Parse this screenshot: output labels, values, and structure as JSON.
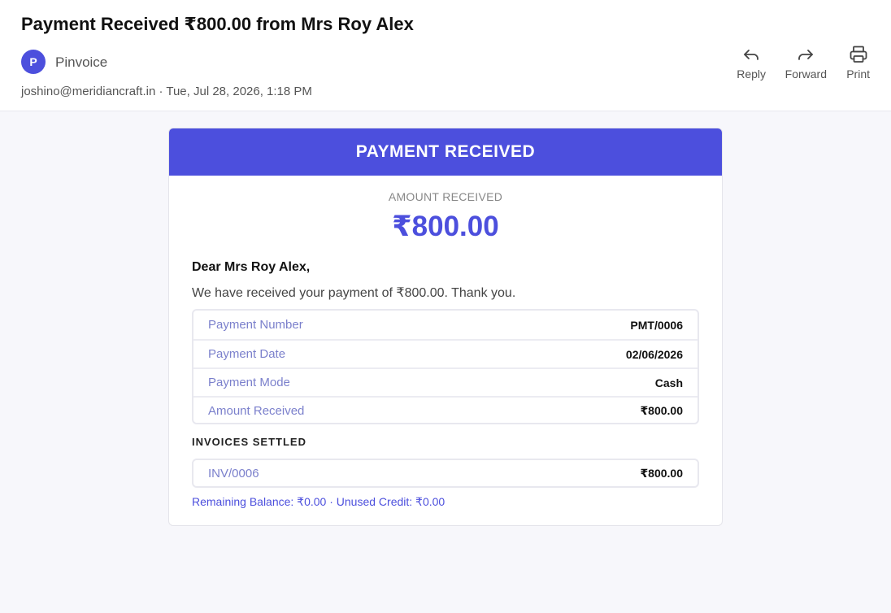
{
  "email": {
    "subject": "Payment Received ₹800.00 from Mrs Roy Alex",
    "sender": {
      "avatar_letter": "P",
      "name": "Pinvoice",
      "meta": "joshino@meridiancraft.in · Tue, Jul 28, 2026, 1:18 PM"
    },
    "actions": {
      "reply": "Reply",
      "forward": "Forward",
      "print": "Print"
    }
  },
  "receipt": {
    "banner": "PAYMENT RECEIVED",
    "amount_label": "AMOUNT RECEIVED",
    "amount": "₹800.00",
    "greeting": "Dear Mrs Roy Alex,",
    "message": "We have received your payment of ₹800.00. Thank you.",
    "details": [
      {
        "label": "Payment Number",
        "value": "PMT/0006"
      },
      {
        "label": "Payment Date",
        "value": "02/06/2026"
      },
      {
        "label": "Payment Mode",
        "value": "Cash"
      },
      {
        "label": "Amount Received",
        "value": "₹800.00"
      }
    ],
    "invoices_heading": "INVOICES SETTLED",
    "invoices": [
      {
        "number": "INV/0006",
        "amount": "₹800.00"
      }
    ],
    "balance_line": "Remaining Balance: ₹0.00 · Unused Credit: ₹0.00"
  },
  "colors": {
    "accent": "#4c4fdd",
    "label": "#7b80cc",
    "background": "#f7f7fb"
  }
}
